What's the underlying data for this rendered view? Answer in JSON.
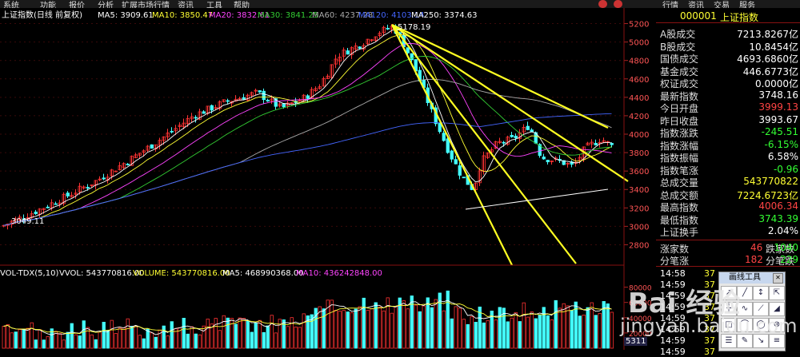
{
  "menu": [
    "系统",
    "功能",
    "报价",
    "分析",
    "扩展市场行情",
    "资讯",
    "工具",
    "帮助"
  ],
  "top_tabs": [
    "行情",
    "资讯",
    "交易",
    "服务"
  ],
  "chart_header": {
    "title": "上证指数(日线 前复权)",
    "items": [
      {
        "label": "MA5: 3909.61",
        "color": "#ffffff"
      },
      {
        "label": "MA10: 3850.47",
        "color": "#ffff33"
      },
      {
        "label": "MA20: 3832.61",
        "color": "#ff44ff"
      },
      {
        "label": "MA30: 3841.25",
        "color": "#33cc33"
      },
      {
        "label": "MA60: 4237.28",
        "color": "#aaaaaa"
      },
      {
        "label": "MA120: 4103.14",
        "color": "#4466ff"
      },
      {
        "label": "MA250: 3374.63",
        "color": "#ffffff"
      }
    ]
  },
  "annotations": {
    "high": "5178.19",
    "low": "3049.11"
  },
  "volume_header": [
    {
      "label": "VOL-TDX(5,10)",
      "color": "#ffffff"
    },
    {
      "label": "VVOL: 543770816.00",
      "color": "#ffffff"
    },
    {
      "label": "VOLUME: 543770816.00",
      "color": "#ffff33"
    },
    {
      "label": "MA5: 468990368.00",
      "color": "#ffffff"
    },
    {
      "label": "MA10: 436242848.00",
      "color": "#ff44ff"
    }
  ],
  "chart_data": {
    "type": "candlestick",
    "price_ticks": [
      2800,
      3000,
      3200,
      3400,
      3600,
      3800,
      4000,
      4200,
      4400,
      4600,
      4800,
      5000,
      5200
    ],
    "ylim": [
      2700,
      5300
    ],
    "volume_ticks": [
      "80000",
      "60000",
      "40000",
      "20000"
    ],
    "volume_ylim": [
      0,
      90000
    ]
  },
  "panel": {
    "code": "000001",
    "name": "上证指数",
    "rows": [
      {
        "label": "A股成交",
        "value": "7213.8267亿",
        "color": "#ffffff"
      },
      {
        "label": "B股成交",
        "value": "10.8454亿",
        "color": "#ffffff"
      },
      {
        "label": "国债成交",
        "value": "4693.6860亿",
        "color": "#ffffff"
      },
      {
        "label": "基金成交",
        "value": "446.6773亿",
        "color": "#ffffff"
      },
      {
        "label": "权证成交",
        "value": "0.0000亿",
        "color": "#ffffff"
      },
      {
        "label": "最新指数",
        "value": "3748.16",
        "color": "#ffffff"
      },
      {
        "label": "今日开盘",
        "value": "3999.13",
        "color": "#ff4444"
      },
      {
        "label": "昨日收盘",
        "value": "3993.67",
        "color": "#ffffff"
      },
      {
        "label": "指数涨跌",
        "value": "-245.51",
        "color": "#33ff33"
      },
      {
        "label": "指数涨幅",
        "value": "-6.15%",
        "color": "#33ff33"
      },
      {
        "label": "指数振幅",
        "value": "6.58%",
        "color": "#ffffff"
      },
      {
        "label": "指数笔涨",
        "value": "-0.96",
        "color": "#33ff33"
      },
      {
        "label": "总成交量",
        "value": "543770822",
        "color": "#ffff33"
      },
      {
        "label": "总成交额",
        "value": "7224.6723亿",
        "color": "#ffff33"
      },
      {
        "label": "最高指数",
        "value": "4006.34",
        "color": "#ff4444"
      },
      {
        "label": "最低指数",
        "value": "3743.39",
        "color": "#33ff33"
      },
      {
        "label": "上证换手",
        "value": "2.04%",
        "color": "#ffffff"
      }
    ],
    "rise_label": "涨家数",
    "rise_value": "46",
    "fall_label": "跌家数",
    "fall_value": "1040",
    "up_label": "分笔涨",
    "up_value": "182",
    "down_label": "分笔跌",
    "down_value": "229",
    "ticks": [
      {
        "time": "14:58",
        "val": "37"
      },
      {
        "time": "14:59",
        "val": "37"
      },
      {
        "time": "14:59",
        "val": "37"
      },
      {
        "time": "14:59",
        "val": "37"
      },
      {
        "time": "14:59",
        "val": "37"
      },
      {
        "time": "14:59",
        "val": "37"
      },
      {
        "time": "14:59",
        "val": "37"
      },
      {
        "time": "14:59",
        "val": "37"
      }
    ],
    "side_value": "5311"
  },
  "toolbox": {
    "title": "画线工具"
  },
  "watermark": {
    "line1": "Bai 经验",
    "line2": "jingyan.baidu.com"
  }
}
